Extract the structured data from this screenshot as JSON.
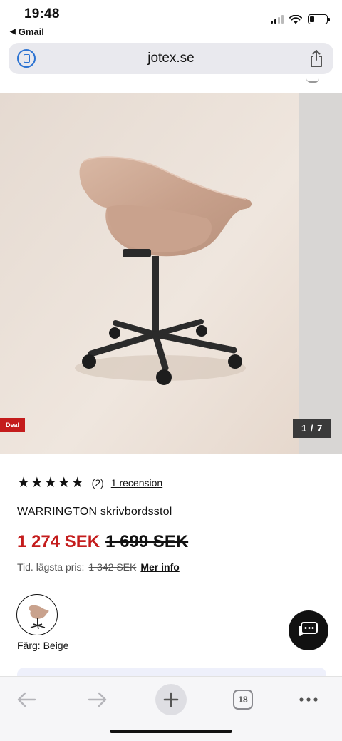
{
  "status_bar": {
    "time": "19:48",
    "back_app": "Gmail",
    "battery_level": 0.25
  },
  "address_bar": {
    "url": "jotex.se",
    "reader_icon": "reader-mode-icon",
    "share_icon": "share-icon"
  },
  "gallery": {
    "badge": "Deal",
    "counter": "1 / 7"
  },
  "product": {
    "rating_stars": "★★★★★",
    "rating_value": 5,
    "rating_count": "(2)",
    "review_link": "1 recension",
    "title": "WARRINGTON skrivbordsstol",
    "price_current": "1 274 SEK",
    "price_old": "1 699 SEK",
    "lowest_label": "Tid. lägsta pris:",
    "lowest_value": "1 342 SEK",
    "more_info": "Mer info",
    "color_label": "Färg: Beige"
  },
  "toolbar": {
    "tabs_count": "18"
  },
  "colors": {
    "accent_red": "#c41c1c",
    "link_blue": "#2c73d2"
  }
}
